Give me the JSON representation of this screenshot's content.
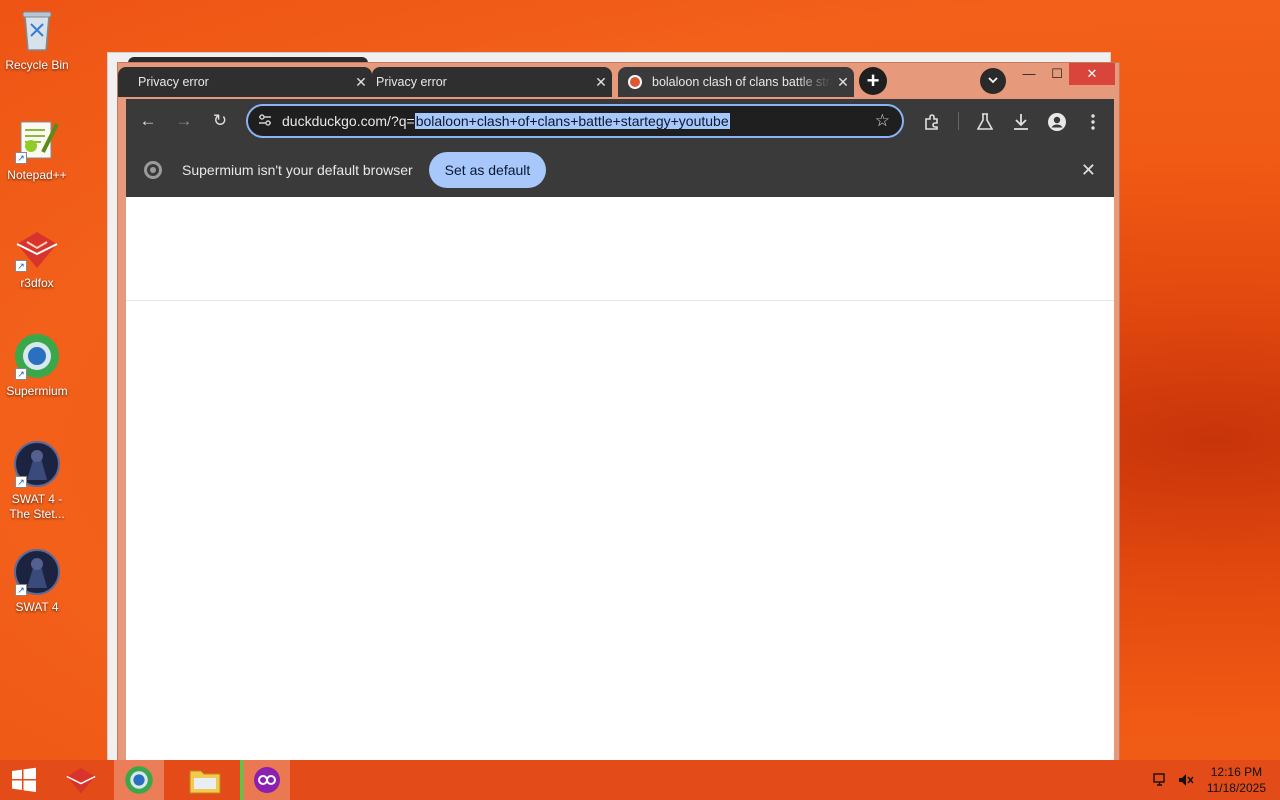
{
  "desktop": {
    "icons": [
      {
        "label": "Recycle Bin",
        "icon": "recycle-bin-icon"
      },
      {
        "label": "Notepad++",
        "icon": "notepad-plus-plus-icon"
      },
      {
        "label": "r3dfox",
        "icon": "r3dfox-icon"
      },
      {
        "label": "Supermium",
        "icon": "supermium-icon"
      },
      {
        "label": "SWAT 4 -\nThe Stet...",
        "icon": "swat4-stetchkov-icon"
      },
      {
        "label": "SWAT 4",
        "icon": "swat4-icon"
      }
    ]
  },
  "browser": {
    "tabs": [
      {
        "title": "Privacy error",
        "close": "✕"
      },
      {
        "title": "Privacy error",
        "close": "✕"
      },
      {
        "title": "bolaloon clash of clans battle stra",
        "close": "✕",
        "active": true
      }
    ],
    "new_tab": "+",
    "window_controls": {
      "minimize": "—",
      "maximize": "☐",
      "close": "✕"
    },
    "toolbar": {
      "back": "←",
      "forward": "→",
      "reload": "↻",
      "url_prefix": "duckduckgo.com/?q=",
      "url_selected": "bolaloon+clash+of+clans+battle+startegy+youtube",
      "bookmark_star": "☆"
    },
    "infobar": {
      "message": "Supermium isn't your default browser",
      "button": "Set as default",
      "close": "✕"
    }
  },
  "taskbar": {
    "clock_time": "12:16 PM",
    "clock_date": "11/18/2025"
  },
  "colors": {
    "desktop": "#f05a14",
    "taskbar": "#e34c18",
    "window_frame": "#e69a7b",
    "chrome_dark": "#3a3a3a",
    "accent": "#a8c7fa"
  }
}
